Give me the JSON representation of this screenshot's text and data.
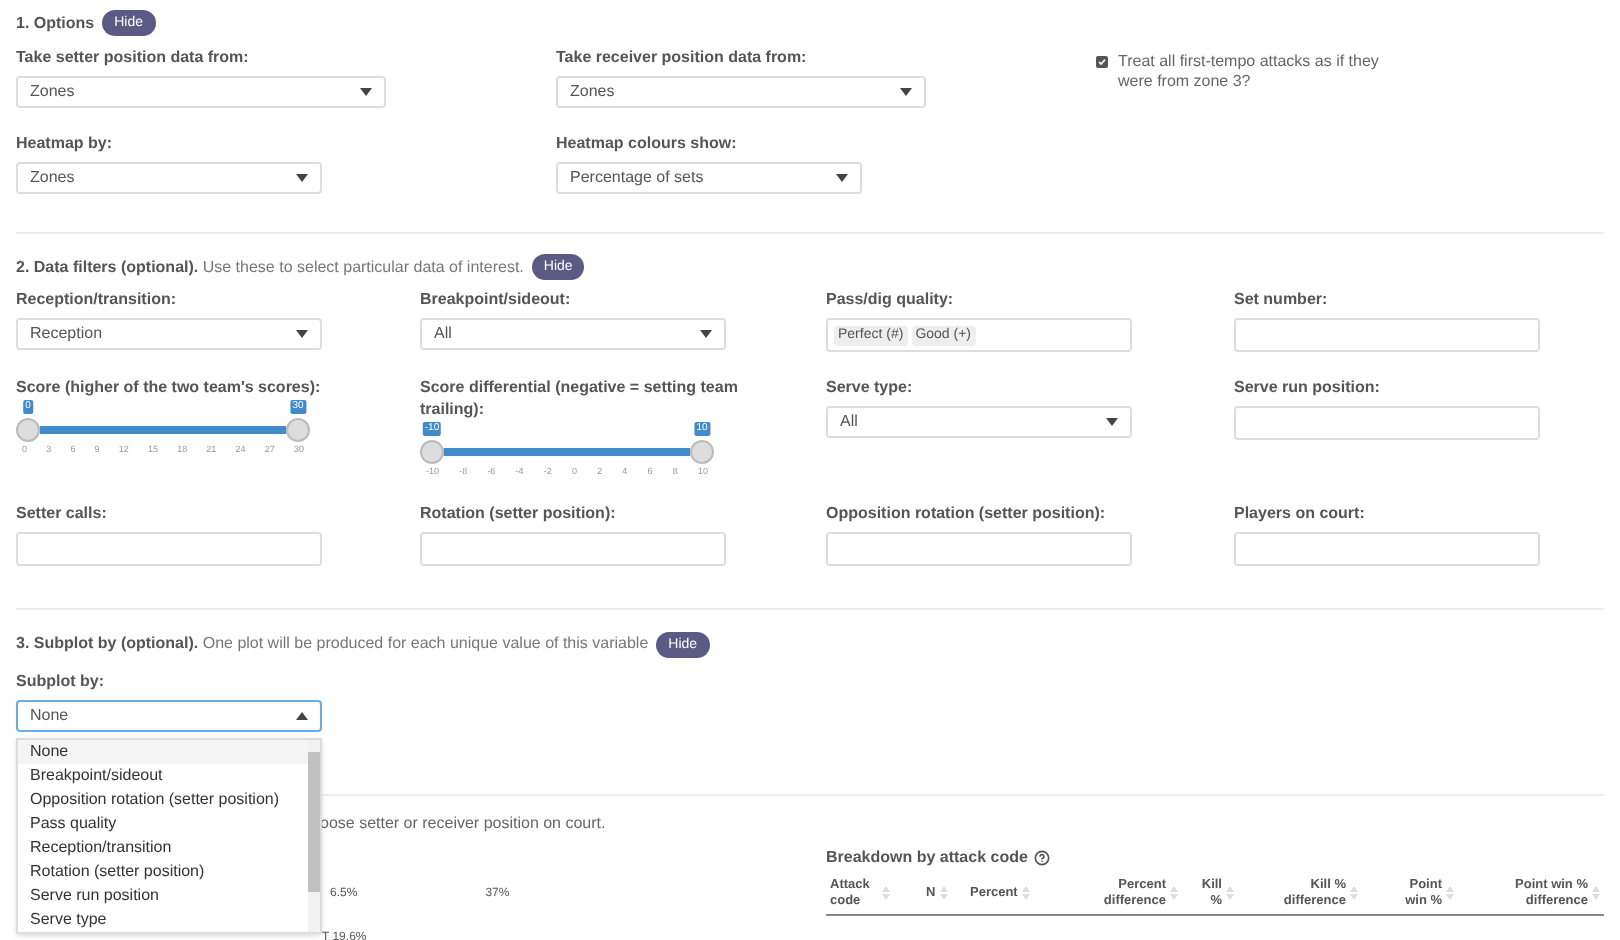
{
  "options": {
    "title": "1. Options",
    "hide_button": "Hide",
    "fields": [
      {
        "kind": "select",
        "label": "Take setter position data from:",
        "value": "Zones"
      },
      {
        "kind": "select",
        "label": "Take receiver position data from:",
        "value": "Zones"
      },
      {
        "kind": "select",
        "label": "Heatmap by:",
        "value": "Zones"
      },
      {
        "kind": "select",
        "label": "Heatmap colours show:",
        "value": "Percentage of sets"
      }
    ],
    "checkbox": {
      "label": "Treat all first-tempo attacks as if they were from zone 3?",
      "checked": true
    }
  },
  "filters": {
    "title": "2. Data filters (optional).",
    "description": "Use these to select particular data of interest.",
    "hide_button": "Hide",
    "fields": [
      {
        "kind": "select",
        "label": "Reception/transition:",
        "value": "Reception"
      },
      {
        "kind": "select",
        "label": "Breakpoint/sideout:",
        "value": "All"
      },
      {
        "kind": "tags",
        "label": "Pass/dig quality:",
        "tags": [
          "Perfect (#)",
          "Good (+)"
        ]
      },
      {
        "kind": "text",
        "label": "Set number:"
      },
      {
        "kind": "slider",
        "label": "Score (higher of the two team's scores):",
        "handles": [
          {
            "label": "0",
            "level": 0
          },
          {
            "label": "30",
            "level": 1
          }
        ],
        "ticks": [
          "0",
          "3",
          "6",
          "9",
          "12",
          "15",
          "18",
          "21",
          "24",
          "27",
          "30"
        ]
      },
      {
        "kind": "slider",
        "label": "Score differential (negative = setting team trailing):",
        "handles": [
          {
            "label": "-10",
            "level": 0
          },
          {
            "label": "10",
            "level": 1
          }
        ],
        "ticks": [
          "-10",
          "-8",
          "-6",
          "-4",
          "-2",
          "0",
          "2",
          "4",
          "6",
          "8",
          "10"
        ]
      },
      {
        "kind": "select",
        "label": "Serve type:",
        "value": "All"
      },
      {
        "kind": "text",
        "label": "Serve run position:"
      },
      {
        "kind": "text",
        "label": "Setter calls:"
      },
      {
        "kind": "text",
        "label": "Rotation (setter position):"
      },
      {
        "kind": "text",
        "label": "Opposition rotation (setter position):"
      },
      {
        "kind": "text",
        "label": "Players on court:"
      }
    ]
  },
  "subplot": {
    "title": "3. Subplot by (optional).",
    "description": "One plot will be produced for each unique value of this variable",
    "hide_button": "Hide",
    "field": {
      "label": "Subplot by:",
      "value": "None",
      "expanded": true,
      "options": [
        {
          "label": "None",
          "selected": true
        },
        {
          "label": "Breakpoint/sideout",
          "selected": false
        },
        {
          "label": "Opposition rotation (setter position)",
          "selected": false
        },
        {
          "label": "Pass quality",
          "selected": false
        },
        {
          "label": "Reception/transition",
          "selected": false
        },
        {
          "label": "Rotation (setter position)",
          "selected": false
        },
        {
          "label": "Serve run position",
          "selected": false
        },
        {
          "label": "Serve type",
          "selected": false
        }
      ]
    }
  },
  "results": {
    "note": "oose setter or receiver position on court.",
    "fragments": [
      {
        "text": "6.5%"
      },
      {
        "text": "37%"
      },
      {
        "text": "T 19.6%"
      }
    ],
    "breakdown": {
      "title": "Breakdown by attack code",
      "columns": [
        "Attack code",
        "N",
        "Percent",
        "Percent difference",
        "Kill %",
        "Kill % difference",
        "Point win %",
        "Point win % difference"
      ]
    }
  }
}
